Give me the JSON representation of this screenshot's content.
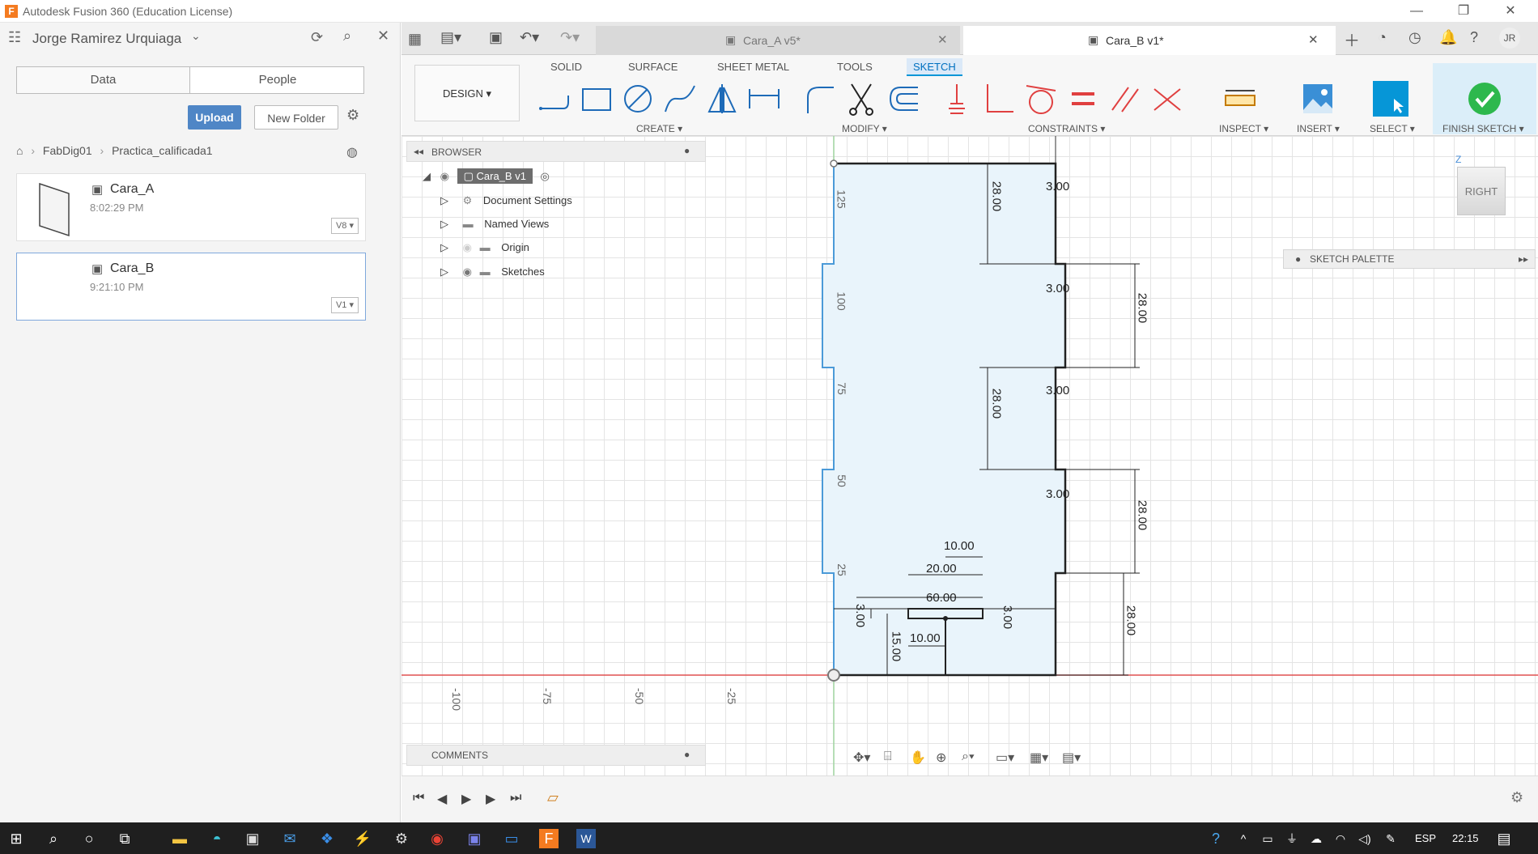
{
  "window": {
    "title": "Autodesk Fusion 360 (Education License)"
  },
  "user": {
    "name": "Jorge Ramirez Urquiaga",
    "initials": "JR"
  },
  "data_panel": {
    "tabs": [
      "Data",
      "People"
    ],
    "upload_label": "Upload",
    "new_folder_label": "New Folder",
    "breadcrumb": [
      "FabDig01",
      "Practica_calificada1"
    ],
    "files": [
      {
        "name": "Cara_A",
        "time": "8:02:29 PM",
        "version": "V8"
      },
      {
        "name": "Cara_B",
        "time": "9:21:10 PM",
        "version": "V1"
      }
    ]
  },
  "doc_tabs": [
    {
      "label": "Cara_A v5*"
    },
    {
      "label": "Cara_B v1*"
    }
  ],
  "ribbon": {
    "design_label": "DESIGN",
    "tabs": [
      "SOLID",
      "SURFACE",
      "SHEET METAL",
      "TOOLS",
      "SKETCH"
    ],
    "groups": [
      "CREATE",
      "MODIFY",
      "CONSTRAINTS",
      "INSPECT",
      "INSERT",
      "SELECT",
      "FINISH SKETCH"
    ]
  },
  "browser": {
    "title": "BROWSER",
    "root": "Cara_B v1",
    "nodes": [
      "Document Settings",
      "Named Views",
      "Origin",
      "Sketches"
    ]
  },
  "comments_label": "COMMENTS",
  "sketch_palette_label": "SKETCH PALETTE",
  "viewcube_label": "RIGHT",
  "axis": {
    "vertical_ticks": [
      "125",
      "100",
      "75",
      "50",
      "25"
    ],
    "horizontal_ticks": [
      "-100",
      "-75",
      "-50",
      "-25"
    ]
  },
  "dimensions": {
    "gap_28": "28.00",
    "notch_3": "3.00",
    "d10": "10.00",
    "d20": "20.00",
    "d60": "60.00",
    "d15": "15.00"
  },
  "taskbar": {
    "lang": "ESP",
    "time": "22:15"
  }
}
